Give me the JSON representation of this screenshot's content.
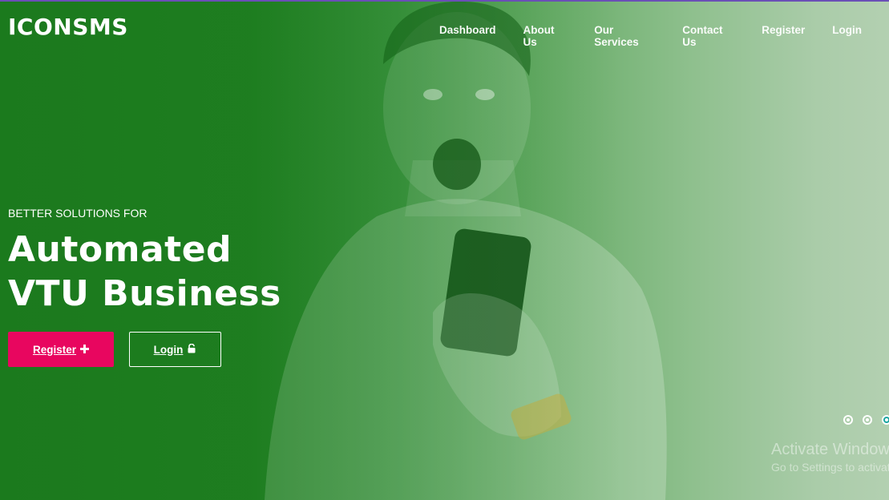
{
  "brand": "ICONSMS",
  "nav": {
    "items": [
      "Dashboard",
      "About Us",
      "Our Services",
      "Contact Us",
      "Register",
      "Login"
    ]
  },
  "hero": {
    "kicker": "BETTER SOLUTIONS FOR",
    "title_line1": "Automated",
    "title_line2": "VTU Business",
    "register_label": "Register",
    "login_label": "Login",
    "register_icon": "plus-icon",
    "login_icon": "unlock-icon"
  },
  "carousel": {
    "slides": 3,
    "active_index": 2
  },
  "watermark": {
    "line1": "Activate Windows",
    "line2": "Go to Settings to activate Windows."
  },
  "colors": {
    "hero_green": "#1b7a1d",
    "accent_pink": "#e8065f",
    "active_dot": "#1aa5a0"
  }
}
